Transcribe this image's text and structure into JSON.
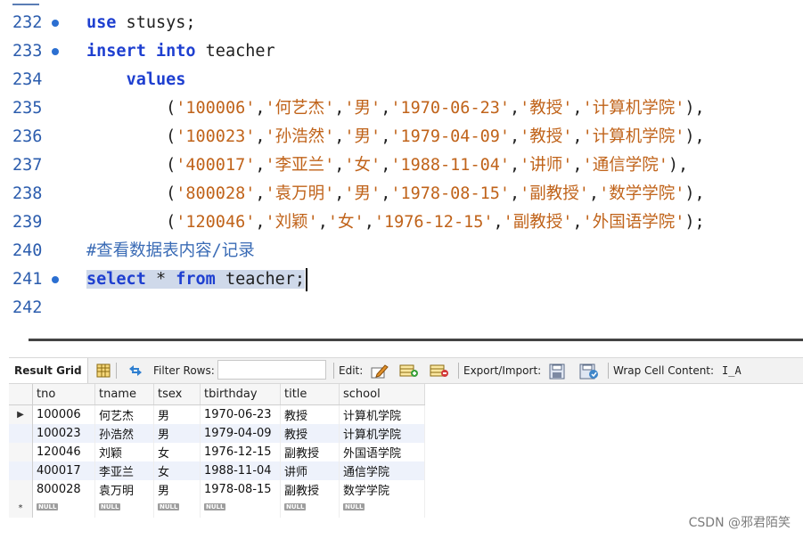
{
  "editor": {
    "top_line_number": "232",
    "lines": [
      {
        "num": "232",
        "marker": true,
        "tokens": [
          {
            "t": "use",
            "c": "kw"
          },
          {
            "t": " stusys;",
            "c": "punct"
          }
        ]
      },
      {
        "num": "233",
        "marker": true,
        "tokens": [
          {
            "t": "insert",
            "c": "kw"
          },
          {
            "t": " ",
            "c": "punct"
          },
          {
            "t": "into",
            "c": "kw"
          },
          {
            "t": " teacher",
            "c": "punct"
          }
        ]
      },
      {
        "num": "234",
        "marker": false,
        "tokens": [
          {
            "t": "    ",
            "c": "punct"
          },
          {
            "t": "values",
            "c": "kw"
          }
        ]
      },
      {
        "num": "235",
        "marker": false,
        "tokens": [
          {
            "t": "        (",
            "c": "punct"
          },
          {
            "t": "'100006'",
            "c": "str"
          },
          {
            "t": ",",
            "c": "punct"
          },
          {
            "t": "'何艺杰'",
            "c": "str"
          },
          {
            "t": ",",
            "c": "punct"
          },
          {
            "t": "'男'",
            "c": "str"
          },
          {
            "t": ",",
            "c": "punct"
          },
          {
            "t": "'1970-06-23'",
            "c": "str"
          },
          {
            "t": ",",
            "c": "punct"
          },
          {
            "t": "'教授'",
            "c": "str"
          },
          {
            "t": ",",
            "c": "punct"
          },
          {
            "t": "'计算机学院'",
            "c": "str"
          },
          {
            "t": "),",
            "c": "punct"
          }
        ]
      },
      {
        "num": "236",
        "marker": false,
        "tokens": [
          {
            "t": "        (",
            "c": "punct"
          },
          {
            "t": "'100023'",
            "c": "str"
          },
          {
            "t": ",",
            "c": "punct"
          },
          {
            "t": "'孙浩然'",
            "c": "str"
          },
          {
            "t": ",",
            "c": "punct"
          },
          {
            "t": "'男'",
            "c": "str"
          },
          {
            "t": ",",
            "c": "punct"
          },
          {
            "t": "'1979-04-09'",
            "c": "str"
          },
          {
            "t": ",",
            "c": "punct"
          },
          {
            "t": "'教授'",
            "c": "str"
          },
          {
            "t": ",",
            "c": "punct"
          },
          {
            "t": "'计算机学院'",
            "c": "str"
          },
          {
            "t": "),",
            "c": "punct"
          }
        ]
      },
      {
        "num": "237",
        "marker": false,
        "tokens": [
          {
            "t": "        (",
            "c": "punct"
          },
          {
            "t": "'400017'",
            "c": "str"
          },
          {
            "t": ",",
            "c": "punct"
          },
          {
            "t": "'李亚兰'",
            "c": "str"
          },
          {
            "t": ",",
            "c": "punct"
          },
          {
            "t": "'女'",
            "c": "str"
          },
          {
            "t": ",",
            "c": "punct"
          },
          {
            "t": "'1988-11-04'",
            "c": "str"
          },
          {
            "t": ",",
            "c": "punct"
          },
          {
            "t": "'讲师'",
            "c": "str"
          },
          {
            "t": ",",
            "c": "punct"
          },
          {
            "t": "'通信学院'",
            "c": "str"
          },
          {
            "t": "),",
            "c": "punct"
          }
        ]
      },
      {
        "num": "238",
        "marker": false,
        "tokens": [
          {
            "t": "        (",
            "c": "punct"
          },
          {
            "t": "'800028'",
            "c": "str"
          },
          {
            "t": ",",
            "c": "punct"
          },
          {
            "t": "'袁万明'",
            "c": "str"
          },
          {
            "t": ",",
            "c": "punct"
          },
          {
            "t": "'男'",
            "c": "str"
          },
          {
            "t": ",",
            "c": "punct"
          },
          {
            "t": "'1978-08-15'",
            "c": "str"
          },
          {
            "t": ",",
            "c": "punct"
          },
          {
            "t": "'副教授'",
            "c": "str"
          },
          {
            "t": ",",
            "c": "punct"
          },
          {
            "t": "'数学学院'",
            "c": "str"
          },
          {
            "t": "),",
            "c": "punct"
          }
        ]
      },
      {
        "num": "239",
        "marker": false,
        "tokens": [
          {
            "t": "        (",
            "c": "punct"
          },
          {
            "t": "'120046'",
            "c": "str"
          },
          {
            "t": ",",
            "c": "punct"
          },
          {
            "t": "'刘颖'",
            "c": "str"
          },
          {
            "t": ",",
            "c": "punct"
          },
          {
            "t": "'女'",
            "c": "str"
          },
          {
            "t": ",",
            "c": "punct"
          },
          {
            "t": "'1976-12-15'",
            "c": "str"
          },
          {
            "t": ",",
            "c": "punct"
          },
          {
            "t": "'副教授'",
            "c": "str"
          },
          {
            "t": ",",
            "c": "punct"
          },
          {
            "t": "'外国语学院'",
            "c": "str"
          },
          {
            "t": ");",
            "c": "punct"
          }
        ]
      },
      {
        "num": "240",
        "marker": false,
        "tokens": [
          {
            "t": "#查看数据表内容/记录",
            "c": "cmt"
          }
        ]
      },
      {
        "num": "241",
        "marker": true,
        "selected": true,
        "tokens": [
          {
            "t": "select",
            "c": "kw"
          },
          {
            "t": " * ",
            "c": "punct"
          },
          {
            "t": "from",
            "c": "kw"
          },
          {
            "t": " teacher;",
            "c": "punct"
          }
        ]
      },
      {
        "num": "242",
        "marker": false,
        "tokens": []
      }
    ]
  },
  "toolbar": {
    "result_grid_label": "Result Grid",
    "filter_rows_label": "Filter Rows:",
    "filter_value": "",
    "edit_label": "Edit:",
    "export_import_label": "Export/Import:",
    "wrap_cell_label": "Wrap Cell Content:",
    "wrap_icon_glyph": "I̲A"
  },
  "grid": {
    "columns": [
      "tno",
      "tname",
      "tsex",
      "tbirthday",
      "title",
      "school"
    ],
    "rows": [
      [
        "100006",
        "何艺杰",
        "男",
        "1970-06-23",
        "教授",
        "计算机学院"
      ],
      [
        "100023",
        "孙浩然",
        "男",
        "1979-04-09",
        "教授",
        "计算机学院"
      ],
      [
        "120046",
        "刘颖",
        "女",
        "1976-12-15",
        "副教授",
        "外国语学院"
      ],
      [
        "400017",
        "李亚兰",
        "女",
        "1988-11-04",
        "讲师",
        "通信学院"
      ],
      [
        "800028",
        "袁万明",
        "男",
        "1978-08-15",
        "副教授",
        "数学学院"
      ]
    ],
    "current_row_marker": "▶",
    "new_row_marker": "*",
    "null_label": "NULL"
  },
  "watermark": "CSDN @邪君陌笑"
}
